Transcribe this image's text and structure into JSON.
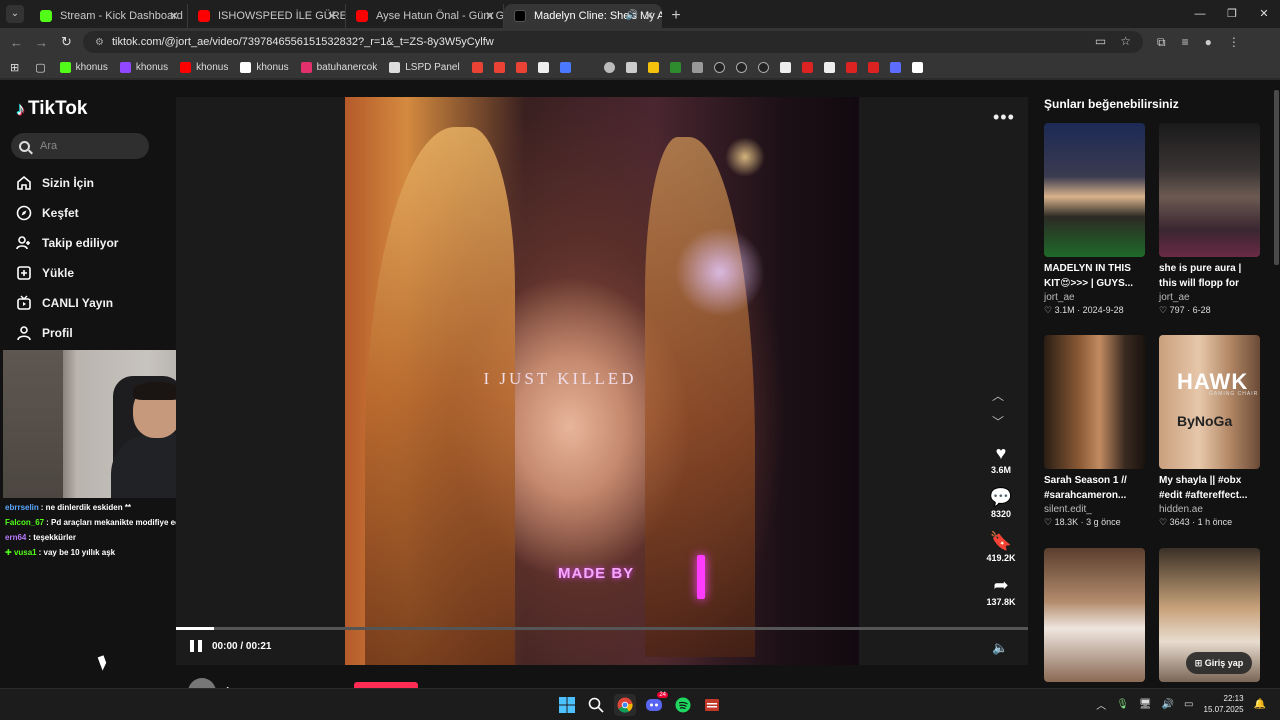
{
  "browser": {
    "tabs": [
      {
        "title": "Stream - Kick Dashboard",
        "favicon_color": "#53fc18",
        "active": false
      },
      {
        "title": "ISHOWSPEED İLE GÜREŞTİM! @",
        "favicon_color": "#ff0000",
        "active": false
      },
      {
        "title": "Ayse Hatun Önal - Güm Güm (",
        "favicon_color": "#ff0000",
        "active": false
      },
      {
        "title": "Madelyn Cline: She's My Al",
        "favicon_color": "#000000",
        "active": true
      }
    ],
    "url": "tiktok.com/@jort_ae/video/7397846556151532832?_r=1&_t=ZS-8y3W5yCylfw",
    "bookmarks": [
      {
        "label": "khonus",
        "color": "#53fc18"
      },
      {
        "label": "khonus",
        "color": "#9146ff"
      },
      {
        "label": "khonus",
        "color": "#ff0000"
      },
      {
        "label": "khonus",
        "color": "#ffffff"
      },
      {
        "label": "batuhanercok",
        "color": "#e1306c"
      },
      {
        "label": "LSPD Panel",
        "color": "#dddddd"
      }
    ]
  },
  "tiktok": {
    "logo": "TikTok",
    "search_placeholder": "Ara",
    "nav": [
      {
        "label": "Sizin İçin",
        "icon": "home-icon"
      },
      {
        "label": "Keşfet",
        "icon": "compass-icon"
      },
      {
        "label": "Takip ediliyor",
        "icon": "user-follow-icon"
      },
      {
        "label": "Yükle",
        "icon": "upload-icon"
      },
      {
        "label": "CANLI Yayın",
        "icon": "live-icon"
      },
      {
        "label": "Profil",
        "icon": "profile-icon"
      }
    ],
    "video": {
      "overlay_text_1": "I JUST KILLED",
      "overlay_text_2": "MADE BY",
      "time": "00:00 / 00:21",
      "progress": 0.045,
      "likes": "3.6M",
      "comments": "8320",
      "saves": "419.2K",
      "shares": "137.8K",
      "author": "jort_ae"
    },
    "recommendations_title": "Şunları beğenebilirsiniz",
    "recommendations": [
      {
        "title": "MADELYN IN THIS KIT😍>>> | GUYS...",
        "author": "jort_ae",
        "likes": "3.1M",
        "date": "2024-9-28"
      },
      {
        "title": "she is pure aura | this will flopp for sure...",
        "author": "jort_ae",
        "likes": "797",
        "date": "6-28"
      },
      {
        "title": "Sarah Season 1 // #sarahcameron...",
        "author": "silent.edit_",
        "likes": "18.3K",
        "date": "3 g önce"
      },
      {
        "title": "My shayla || #obx #edit #aftereffect...",
        "author": "hidden.ae",
        "likes": "3643",
        "date": "1 h önce"
      }
    ],
    "thumb_text": {
      "hawk": "HAWK",
      "gaming": "GAMING CHAIR",
      "bynogame": "ByNoGa"
    },
    "login_button": "Giriş yap"
  },
  "stream_chat": [
    {
      "user": "ebrrselin",
      "user_color": "#5aa7ff",
      "message": ": ne dinlerdik eskiden **"
    },
    {
      "user": "Falcon_67",
      "user_color": "#53fc18",
      "message": ": Pd araçları mekanikte modifiye ediliyormu"
    },
    {
      "user": "ern64",
      "user_color": "#b57bff",
      "message": ": teşekkürler"
    },
    {
      "user": "vusa1",
      "user_color": "#53fc18",
      "message": ": vay be 10 yıllık aşk"
    }
  ],
  "taskbar": {
    "time": "22:13",
    "date": "15.07.2025",
    "discord_badge": "24"
  }
}
